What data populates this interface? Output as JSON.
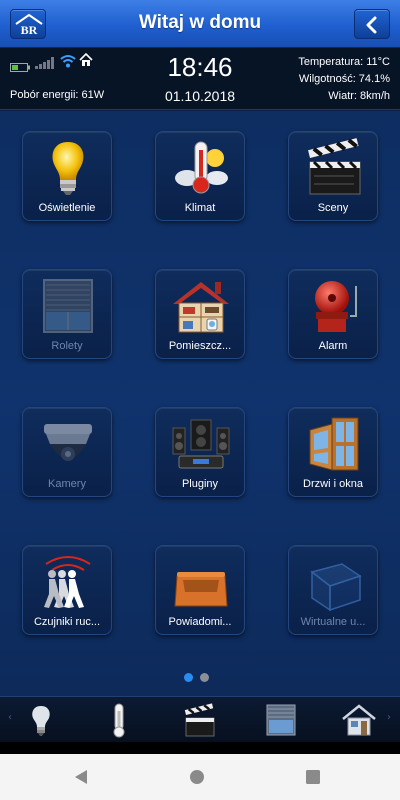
{
  "header": {
    "logo_text": "BR",
    "title": "Witaj w domu"
  },
  "status": {
    "clock": "18:46",
    "date": "01.10.2018",
    "energy": "Pobór energii: 61W",
    "temperature": "Temperatura: 11°C",
    "humidity": "Wilgotność: 74.1%",
    "wind": "Wiatr: 8km/h"
  },
  "tiles": [
    {
      "label": "Oświetlenie",
      "icon": "lightbulb-icon",
      "enabled": true
    },
    {
      "label": "Klimat",
      "icon": "thermometer-weather-icon",
      "enabled": true
    },
    {
      "label": "Sceny",
      "icon": "clapperboard-icon",
      "enabled": true
    },
    {
      "label": "Rolety",
      "icon": "roller-blind-icon",
      "enabled": false
    },
    {
      "label": "Pomieszcz...",
      "icon": "house-rooms-icon",
      "enabled": true
    },
    {
      "label": "Alarm",
      "icon": "alarm-bell-icon",
      "enabled": true
    },
    {
      "label": "Kamery",
      "icon": "dome-camera-icon",
      "enabled": false
    },
    {
      "label": "Pluginy",
      "icon": "stereo-speakers-icon",
      "enabled": true
    },
    {
      "label": "Drzwi i okna",
      "icon": "door-window-icon",
      "enabled": true
    },
    {
      "label": "Czujniki ruc...",
      "icon": "motion-sensor-icon",
      "enabled": true
    },
    {
      "label": "Powiadomi...",
      "icon": "inbox-tray-icon",
      "enabled": true
    },
    {
      "label": "Wirtualne u...",
      "icon": "virtual-cube-icon",
      "enabled": false
    }
  ],
  "pager": {
    "pages": 2,
    "current": 1
  },
  "bottom_shortcuts": [
    "lightbulb-icon",
    "thermometer-icon",
    "clapperboard-icon",
    "roller-blind-icon",
    "house-rooms-icon"
  ],
  "colors": {
    "header_blue": "#2a6ee0",
    "tile_bg": "#0f2c5c",
    "active_dot": "#2a8cf0",
    "inactive_dot": "#8a8f98",
    "disabled_label": "#6f86ab"
  }
}
